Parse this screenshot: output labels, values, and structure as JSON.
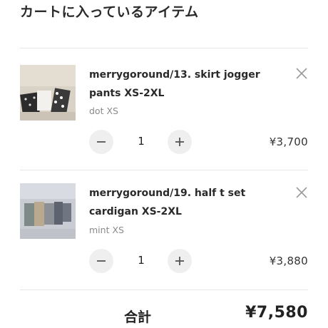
{
  "cart": {
    "title": "カートに入っているアイテム",
    "items": [
      {
        "name": "merrygoround/13. skirt jogger pants XS-2XL",
        "variant": "dot XS",
        "quantity": "1",
        "price": "¥3,700",
        "thumbnail_icon": "product-photo-icon"
      },
      {
        "name": "merrygoround/19. half t set cardigan XS-2XL",
        "variant": "mint XS",
        "quantity": "1",
        "price": "¥3,880",
        "thumbnail_icon": "product-photo-icon"
      }
    ],
    "remove_icon": "close-icon",
    "decrease_icon": "minus-icon",
    "increase_icon": "plus-icon"
  },
  "summary": {
    "total_label": "合計",
    "total_value": "¥7,580"
  },
  "colors": {
    "qty_button_bg": "#efefef",
    "divider": "#e6e6e6",
    "text_primary": "#222222",
    "text_secondary": "#8a8a8a"
  }
}
